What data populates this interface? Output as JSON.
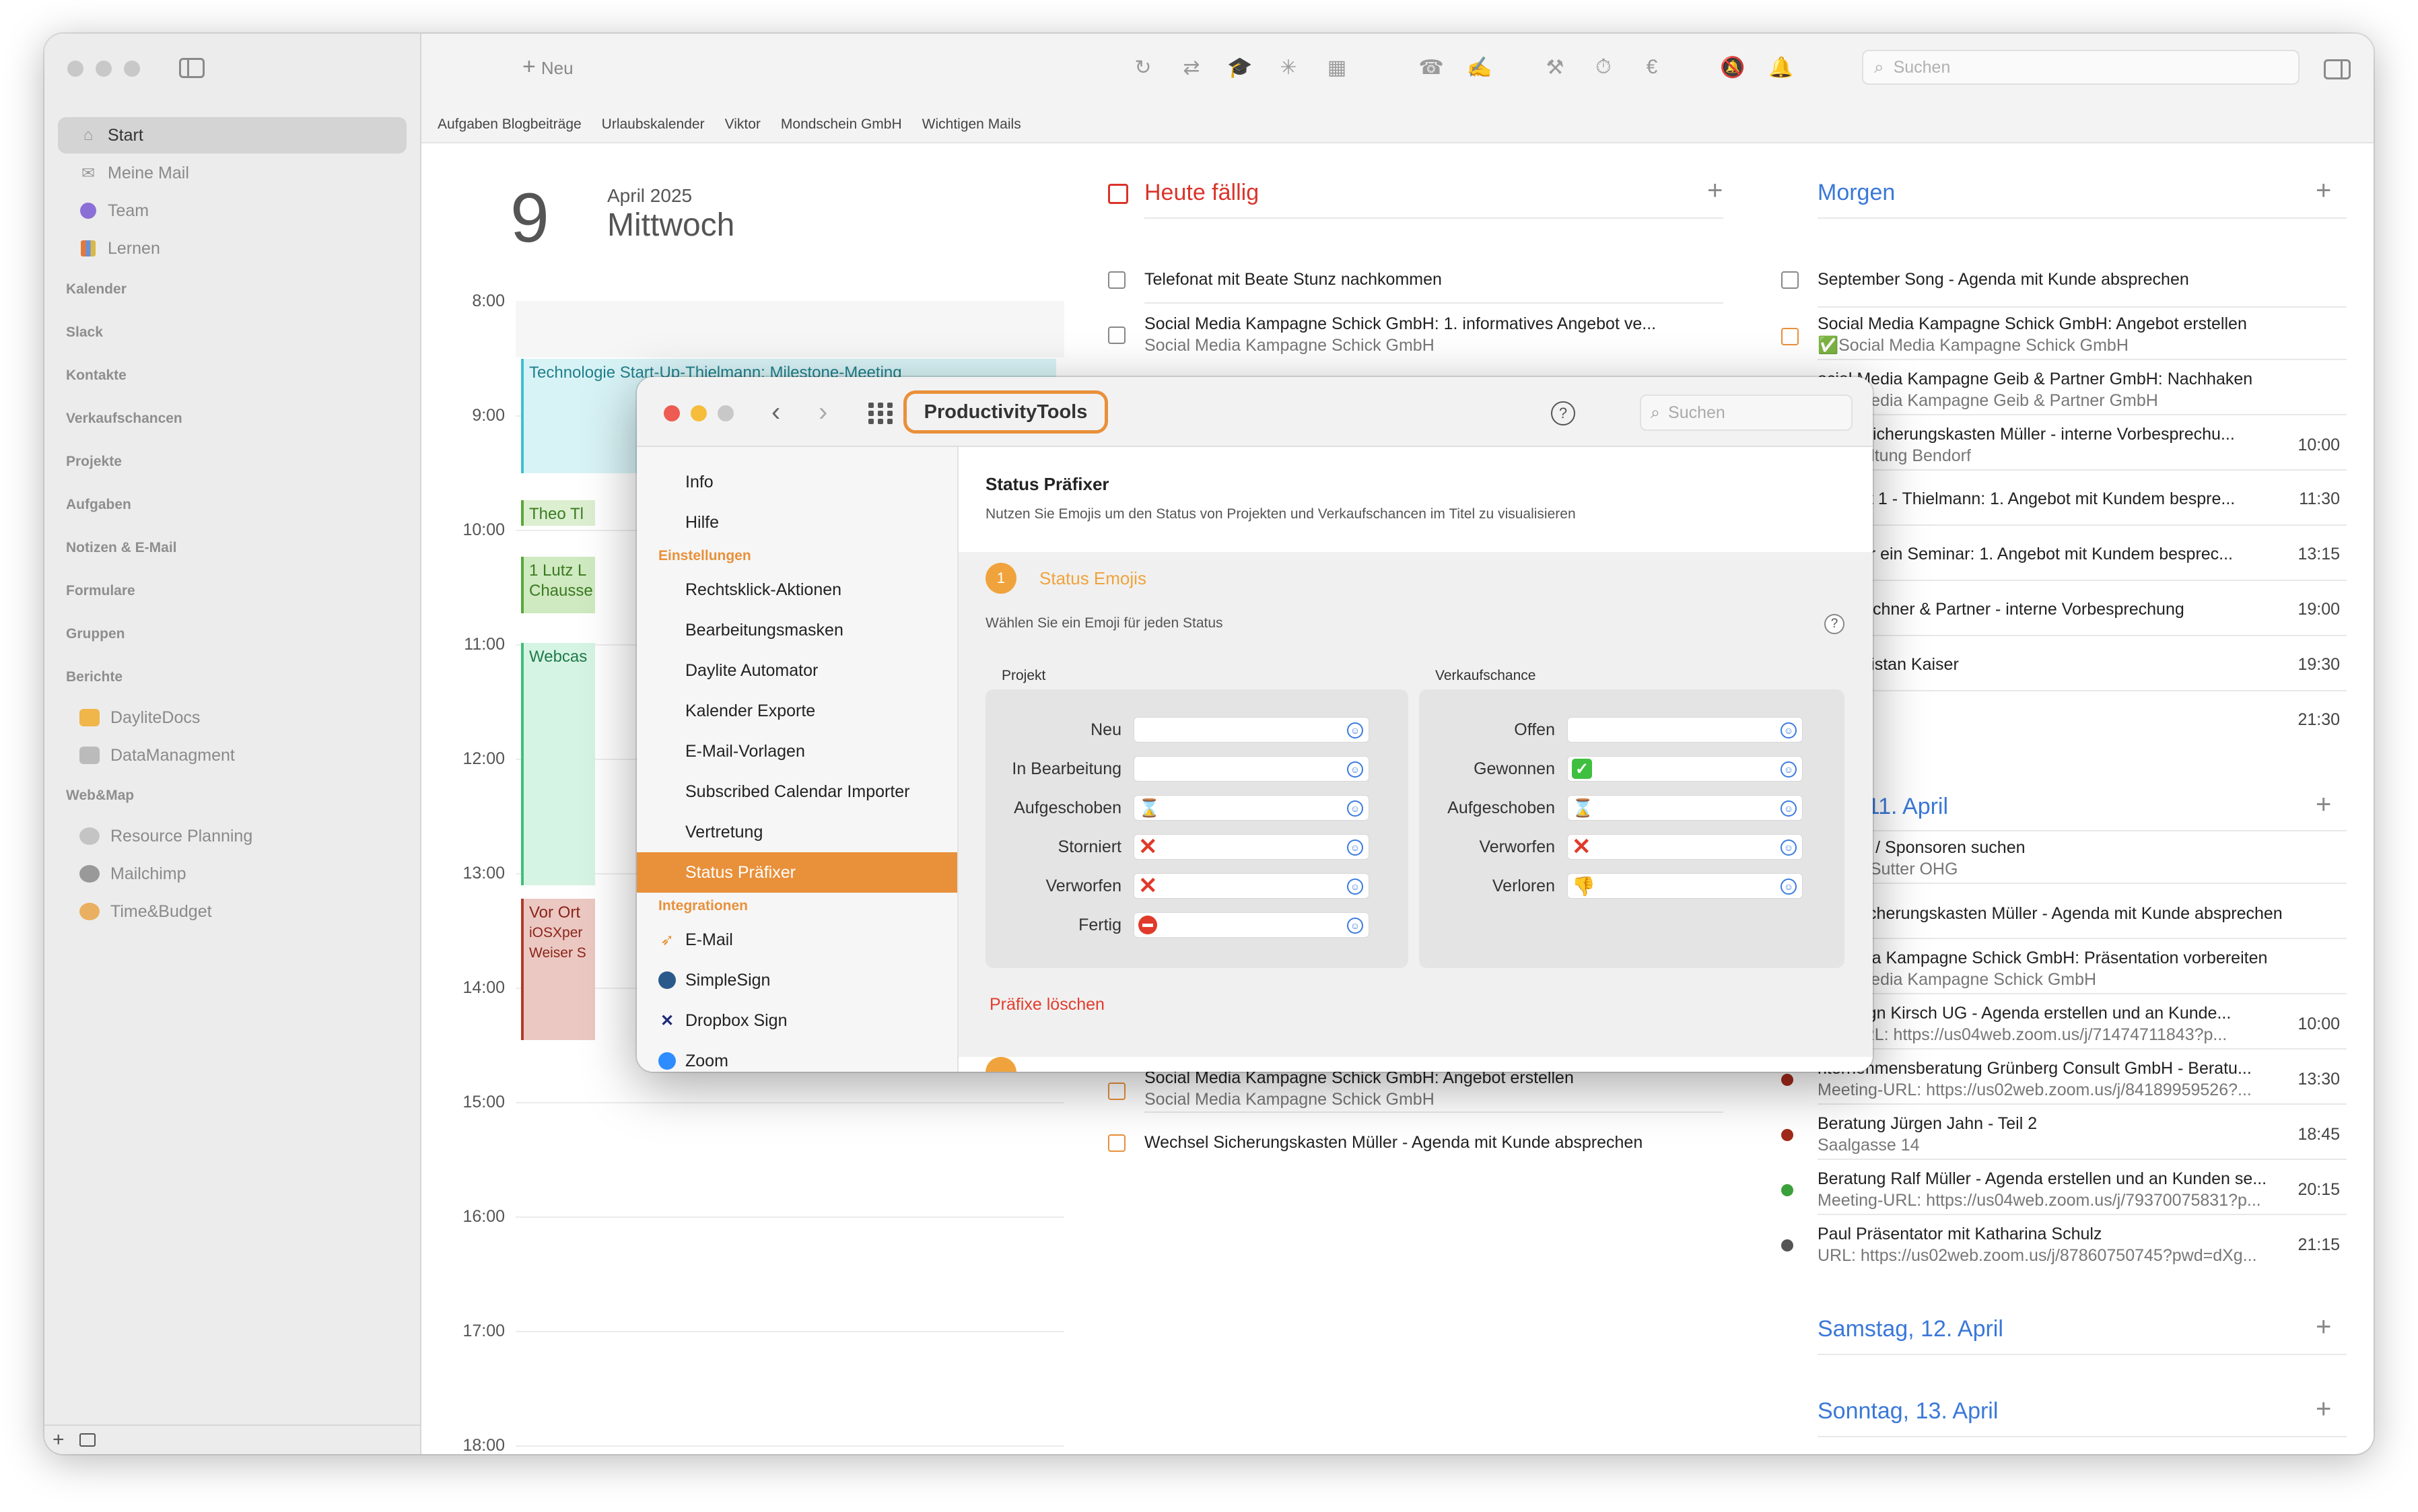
{
  "sidebar": {
    "top_items": [
      {
        "label": "Start",
        "icon": "house-icon",
        "active": true
      },
      {
        "label": "Meine Mail",
        "icon": "envelope-icon",
        "active": false
      },
      {
        "label": "Team",
        "icon": "team-icon",
        "active": false
      },
      {
        "label": "Lernen",
        "icon": "books-icon",
        "active": false
      }
    ],
    "sections": [
      "Kalender",
      "Slack",
      "Kontakte",
      "Verkaufschancen",
      "Projekte",
      "Aufgaben",
      "Notizen & E-Mail",
      "Formulare",
      "Gruppen",
      "Berichte"
    ],
    "berichte_items": [
      "DayliteDocs",
      "DataManagment"
    ],
    "webmap_section": "Web&Map",
    "webmap_items": [
      "Resource Planning",
      "Mailchimp",
      "Time&Budget"
    ]
  },
  "toolbar": {
    "new_label": "Neu",
    "search_placeholder": "Suchen"
  },
  "favorites": [
    "Aufgaben Blogbeiträge",
    "Urlaubskalender",
    "Viktor",
    "Mondschein GmbH",
    "Wichtigen Mails"
  ],
  "day": {
    "number": "9",
    "month": "April 2025",
    "weekday": "Mittwoch",
    "hours": [
      "8:00",
      "9:00",
      "10:00",
      "11:00",
      "12:00",
      "13:00",
      "14:00",
      "15:00",
      "16:00",
      "17:00",
      "18:00"
    ],
    "events": [
      {
        "title": "Technologie Start-Up-Thielmann: Milestone-Meeting"
      },
      {
        "title": "Theo Tl"
      },
      {
        "title": "1 Lutz L",
        "sub": "Chausse"
      },
      {
        "title": "Webcas"
      },
      {
        "title": "Vor Ort",
        "sub": "iOSXper",
        "sub2": "Weiser S"
      }
    ]
  },
  "today": {
    "title": "Heute fällig",
    "tasks": [
      {
        "title": "Telefonat mit Beate Stunz nachkommen"
      },
      {
        "title": "Social Media Kampagne Schick GmbH: 1. informatives Angebot ve...",
        "sub": "Social Media Kampagne Schick GmbH"
      },
      {
        "title": "Social Media Kampagne Schick GmbH: Angebot erstellen",
        "sub": "Social Media Kampagne Schick GmbH"
      },
      {
        "title": "Wechsel Sicherungskasten Müller - Agenda mit Kunde absprechen"
      }
    ]
  },
  "tomorrow": {
    "title": "Morgen",
    "items": [
      {
        "title": "September Song - Agenda mit Kunde absprechen"
      },
      {
        "title": "Social Media Kampagne Schick GmbH: Angebot erstellen",
        "sub": "✅Social Media Kampagne Schick GmbH"
      },
      {
        "title": "ocial Media Kampagne Geib & Partner GmbH: Nachhaken",
        "sub": "ocial Media Kampagne Geib & Partner GmbH"
      },
      {
        "title": "chsel Sicherungskasten Müller - interne Vorbesprechu...",
        "sub": "ltverwaltung Bendorf",
        "time": "10:00"
      },
      {
        "title": "bill Test 1 - Thielmann: 1. Angebot mit Kundem bespre...",
        "time": "11:30"
      },
      {
        "title": "rage für ein Seminar: 1. Angebot mit Kundem besprec...",
        "time": "13:15"
      },
      {
        "title": "seite Eichner & Partner - interne Vorbesprechung",
        "time": "19:00"
      },
      {
        "title": "from Tristan Kaiser",
        "time": "19:30"
      },
      {
        "title": "",
        "time": "21:30"
      }
    ]
  },
  "friday": {
    "title": "itag, 11. April",
    "items": [
      {
        "title": "ssteller / Sponsoren suchen",
        "sub": "ratung Sutter OHG"
      },
      {
        "title": "hsel Sicherungskasten Müller - Agenda mit Kunde absprechen"
      },
      {
        "title": "al Media Kampagne Schick GmbH: Präsentation vorbereiten",
        "sub": "ocial Media Kampagne Schick GmbH"
      },
      {
        "title": "godesign Kirsch UG - Agenda erstellen und an Kunde...",
        "sub": "ting-URL: https://us04web.zoom.us/j/71474711843?p...",
        "time": "10:00"
      },
      {
        "title": "nternehmensberatung Grünberg Consult GmbH - Beratu...",
        "sub": "Meeting-URL: https://us02web.zoom.us/j/84189959526?...",
        "time": "13:30",
        "dot": "#a02a1a"
      },
      {
        "title": "Beratung Jürgen Jahn - Teil 2",
        "sub": "Saalgasse 14",
        "time": "18:45",
        "dot": "#a02a1a"
      },
      {
        "title": "Beratung Ralf Müller - Agenda erstellen und an Kunden se...",
        "sub": "Meeting-URL: https://us04web.zoom.us/j/79370075831?p...",
        "time": "20:15",
        "dot": "#3aa03a"
      },
      {
        "title": "Paul Präsentator mit Katharina Schulz",
        "sub": "URL: https://us02web.zoom.us/j/87860750745?pwd=dXg...",
        "time": "21:15",
        "dot": "#555555"
      }
    ]
  },
  "saturday": {
    "title": "Samstag, 12. April"
  },
  "sunday": {
    "title": "Sonntag, 13. April"
  },
  "dialog": {
    "title": "ProductivityTools",
    "search_placeholder": "Suchen",
    "help": "?",
    "nav_top": [
      "Info",
      "Hilfe"
    ],
    "einstellungen_label": "Einstellungen",
    "nav_settings": [
      "Rechtsklick-Aktionen",
      "Bearbeitungsmasken",
      "Daylite Automator",
      "Kalender Exporte",
      "E-Mail-Vorlagen",
      "Subscribed Calendar Importer",
      "Vertretung",
      "Status Präfixer"
    ],
    "integrationen_label": "Integrationen",
    "nav_integrations": [
      {
        "label": "E-Mail",
        "icon": "paper-plane-icon"
      },
      {
        "label": "SimpleSign",
        "icon": "simplesign-icon"
      },
      {
        "label": "Dropbox Sign",
        "icon": "dropbox-sign-icon"
      },
      {
        "label": "Zoom",
        "icon": "zoom-icon"
      }
    ],
    "content": {
      "title": "Status Präfixer",
      "description": "Nutzen Sie Emojis um den Status von Projekten und Verkaufschancen im Titel zu visualisieren",
      "step_number": "1",
      "step_title": "Status Emojis",
      "step_description": "Wählen Sie ein Emoji für jeden Status",
      "step_help": "?",
      "projekt_label": "Projekt",
      "projekt_rows": [
        {
          "label": "Neu",
          "emoji": ""
        },
        {
          "label": "In Bearbeitung",
          "emoji": ""
        },
        {
          "label": "Aufgeschoben",
          "emoji": "hourglass"
        },
        {
          "label": "Storniert",
          "emoji": "cross"
        },
        {
          "label": "Verworfen",
          "emoji": "cross"
        },
        {
          "label": "Fertig",
          "emoji": "no-entry"
        }
      ],
      "verkauf_label": "Verkaufschance",
      "verkauf_rows": [
        {
          "label": "Offen",
          "emoji": ""
        },
        {
          "label": "Gewonnen",
          "emoji": "check"
        },
        {
          "label": "Aufgeschoben",
          "emoji": "hourglass"
        },
        {
          "label": "Verworfen",
          "emoji": "cross"
        },
        {
          "label": "Verloren",
          "emoji": "thumbs-down"
        }
      ],
      "clear_label": "Präfixe löschen"
    }
  },
  "colors": {
    "accent_orange": "#e9903a",
    "today_red": "#d9342b",
    "link_blue": "#3a78d8"
  }
}
